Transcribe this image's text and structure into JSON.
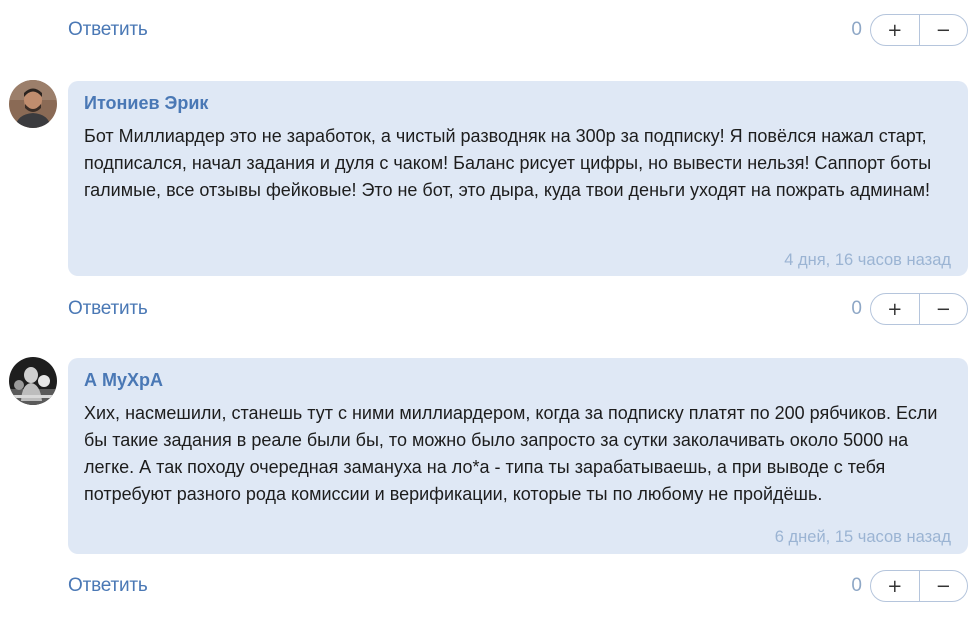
{
  "actions": {
    "reply_label": "Ответить",
    "plus_label": "+",
    "minus_label": "−"
  },
  "top_row": {
    "vote_count": "0"
  },
  "comments": [
    {
      "author": "Итониев Эрик",
      "text": "Бот Миллиардер это не заработок, а чистый разводняк на 300р за подписку! Я повёлся нажал старт, подписался, начал задания и дуля с чаком! Баланс рисует цифры, но вывести нельзя! Саппорт боты галимые, все отзывы фейковые! Это не бот, это дыра, куда твои деньги уходят на пожрать админам!",
      "time": "4 дня, 16 часов назад",
      "vote_count": "0",
      "avatar_icon": "person-photo-avatar"
    },
    {
      "author": "А МуХрА",
      "text": "Хих, насмешили, станешь тут с ними миллиардером, когда за подписку платят по 200 рябчиков. Если бы такие задания в реале были бы, то можно было запросто за сутки заколачивать около 5000 на легке. А так походу очередная замануха на ло*а - типа ты зарабатываешь, а при выводе с тебя потребуют разного рода комиссии и верификации, которые ты по любому не пройдёшь.",
      "time": "6 дней, 15 часов назад",
      "vote_count": "0",
      "avatar_icon": "boxer-photo-avatar"
    }
  ]
}
